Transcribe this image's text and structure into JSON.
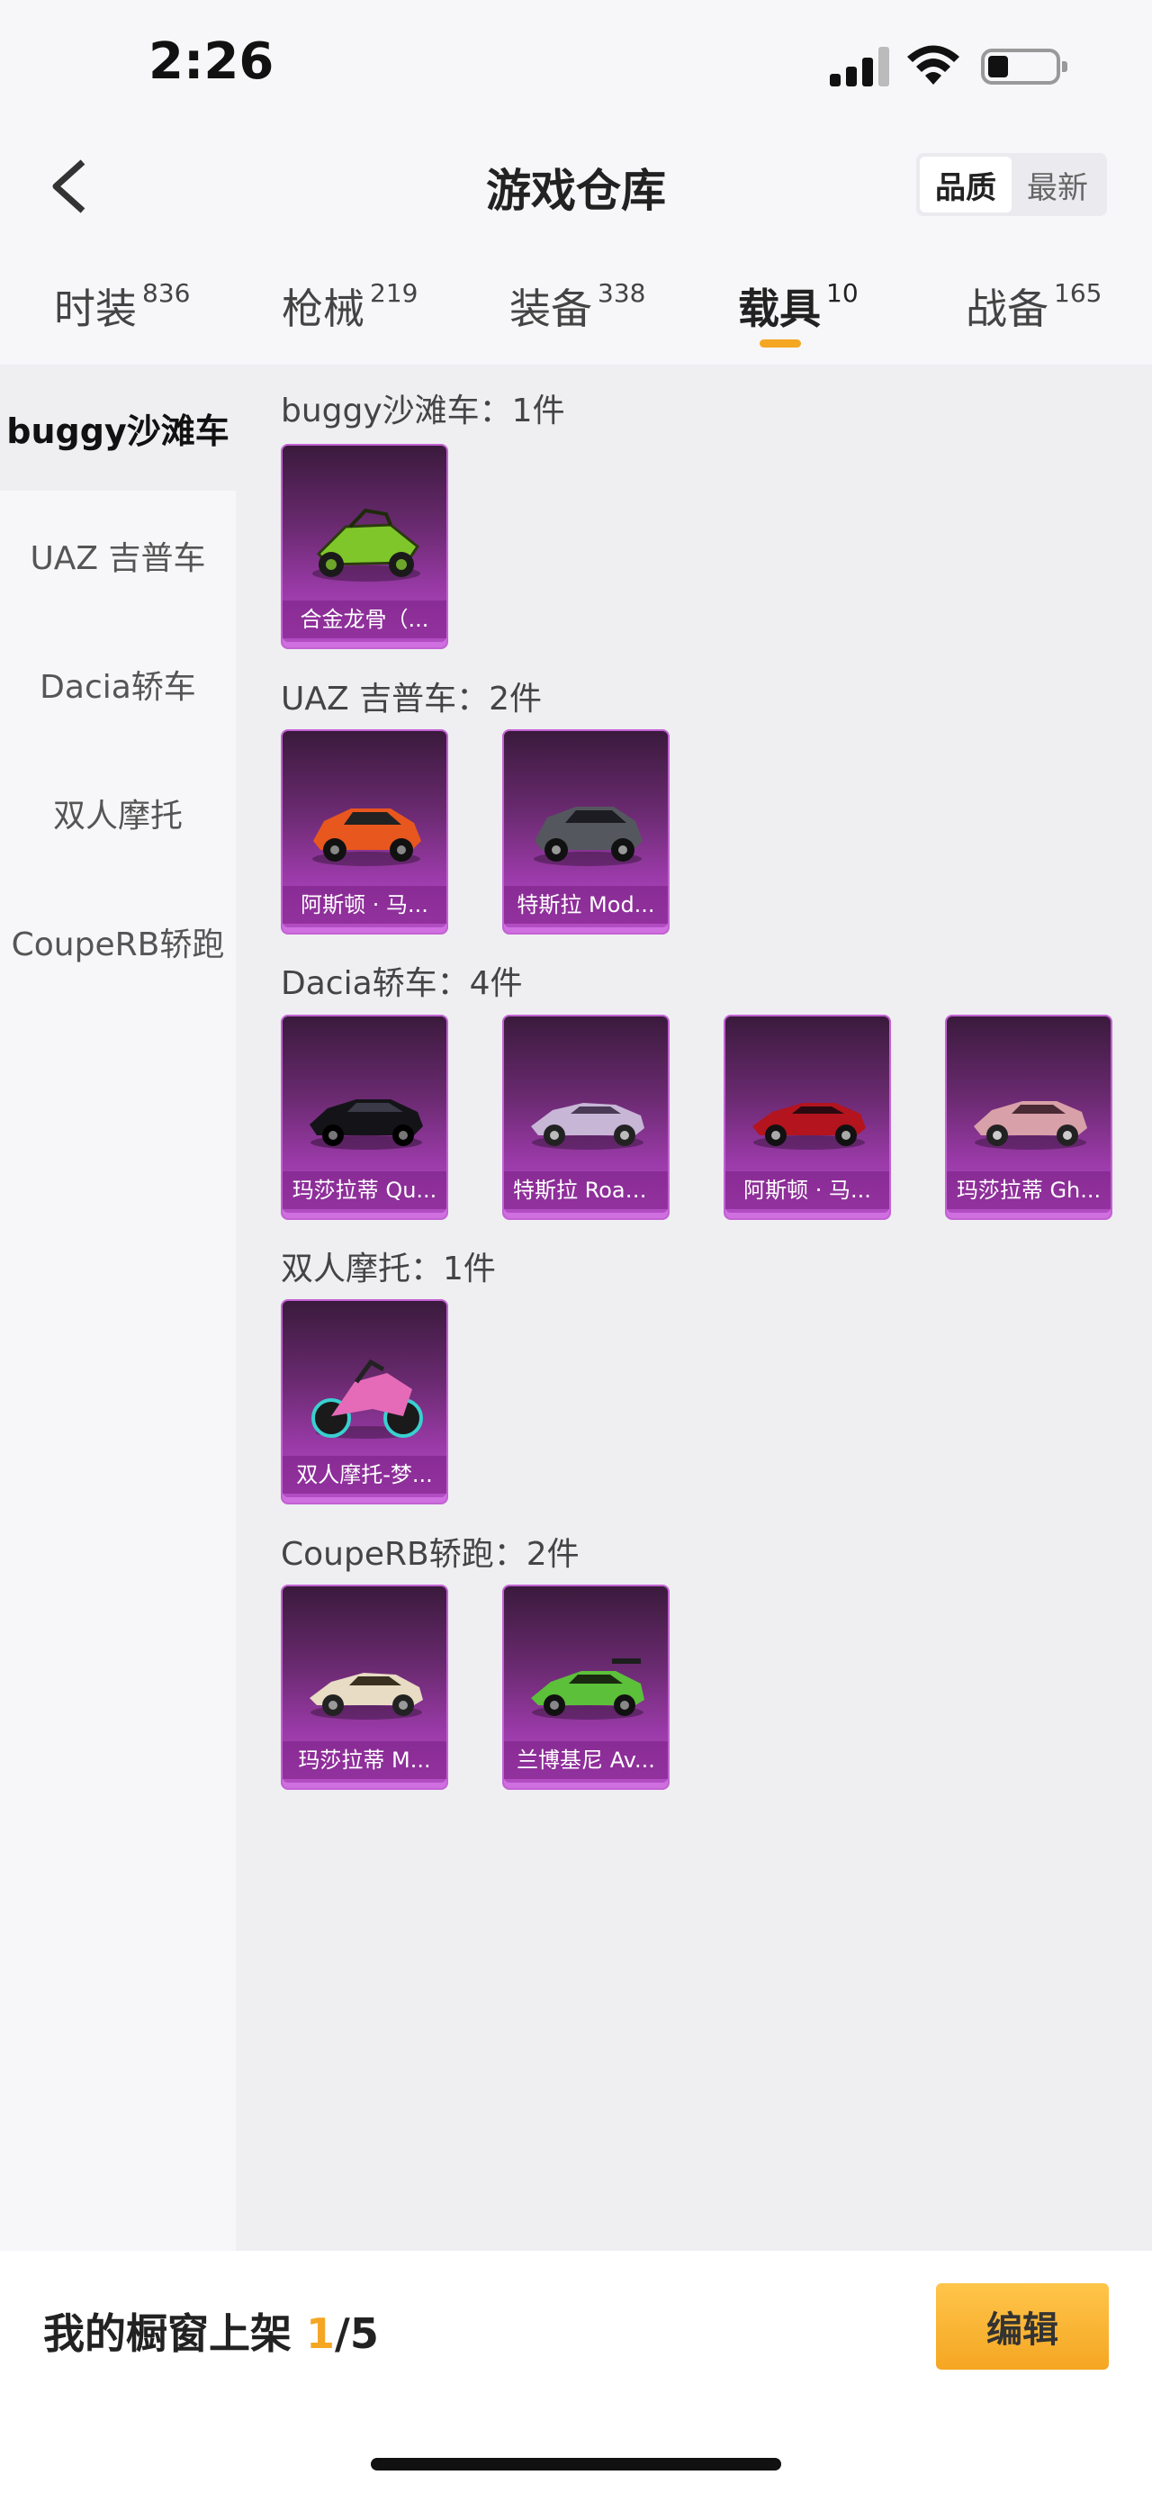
{
  "status_bar": {
    "time": "2:26"
  },
  "header": {
    "title": "游戏仓库",
    "sort_options": [
      "品质",
      "最新"
    ],
    "sort_selected": "品质"
  },
  "tabs": [
    {
      "label": "时装",
      "count": "836"
    },
    {
      "label": "枪械",
      "count": "219"
    },
    {
      "label": "装备",
      "count": "338"
    },
    {
      "label": "载具",
      "count": "10",
      "active": true
    },
    {
      "label": "战备",
      "count": "165"
    }
  ],
  "sidebar": {
    "items": [
      "buggy沙滩车",
      "UAZ 吉普车",
      "Dacia轿车",
      "双人摩托",
      "CoupeRB轿跑"
    ],
    "active": "buggy沙滩车"
  },
  "sections": [
    {
      "title": "buggy沙滩车：1件",
      "items": [
        {
          "name": "合金龙骨（...",
          "icon": "green-buggy-vehicle"
        }
      ]
    },
    {
      "title": "UAZ 吉普车：2件",
      "items": [
        {
          "name": "阿斯顿 · 马...",
          "icon": "orange-suv-vehicle"
        },
        {
          "name": "特斯拉 Mod...",
          "icon": "gray-suv-vehicle"
        }
      ]
    },
    {
      "title": "Dacia轿车：4件",
      "items": [
        {
          "name": "玛莎拉蒂 Qu...",
          "icon": "black-sedan-vehicle"
        },
        {
          "name": "特斯拉 Road...",
          "icon": "silver-roadster-vehicle"
        },
        {
          "name": "阿斯顿 · 马...",
          "icon": "red-coupe-vehicle"
        },
        {
          "name": "玛莎拉蒂 Gh...",
          "icon": "pink-sedan-vehicle"
        }
      ]
    },
    {
      "title": "双人摩托：1件",
      "items": [
        {
          "name": "双人摩托-梦...",
          "icon": "pink-motorcycle-vehicle"
        }
      ]
    },
    {
      "title": "CoupeRB轿跑：2件",
      "items": [
        {
          "name": "玛莎拉蒂 M...",
          "icon": "white-supercar-vehicle"
        },
        {
          "name": "兰博基尼 Av...",
          "icon": "green-supercar-vehicle"
        }
      ]
    }
  ],
  "bottom_bar": {
    "showcase_label": "我的橱窗上架",
    "current": "1",
    "total": "/5",
    "edit_label": "编辑"
  },
  "colors": {
    "accent": "#f5a623",
    "card_purple": "#9a3aa8"
  }
}
